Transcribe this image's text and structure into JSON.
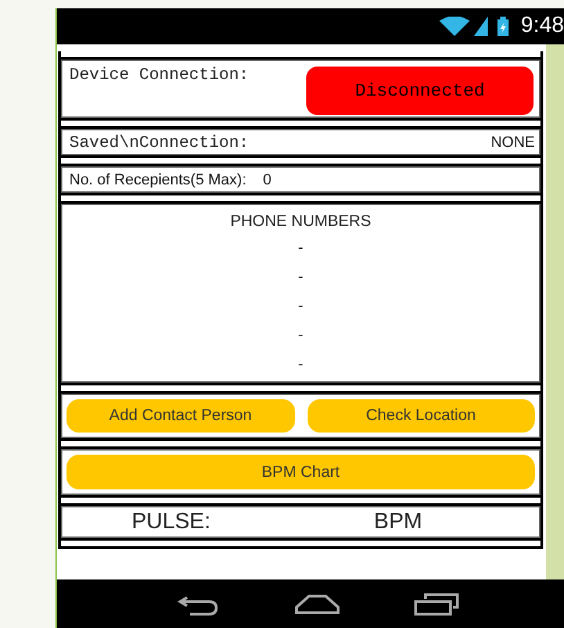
{
  "status_bar": {
    "time": "9:48"
  },
  "device_connection": {
    "label": "Device Connection:",
    "status": "Disconnected",
    "connected": false
  },
  "saved_connection": {
    "label": "Saved\\nConnection:",
    "value": "NONE"
  },
  "recipients": {
    "label": "No. of Recepients(5 Max):",
    "count": "0"
  },
  "phone_numbers": {
    "title": "PHONE NUMBERS",
    "entries": [
      "-",
      "-",
      "-",
      "-",
      "-"
    ]
  },
  "buttons": [
    "Add Contact Person",
    "Check Location"
  ],
  "chart_button": "BPM Chart",
  "pulse": {
    "label": "PULSE:",
    "unit": "BPM"
  }
}
